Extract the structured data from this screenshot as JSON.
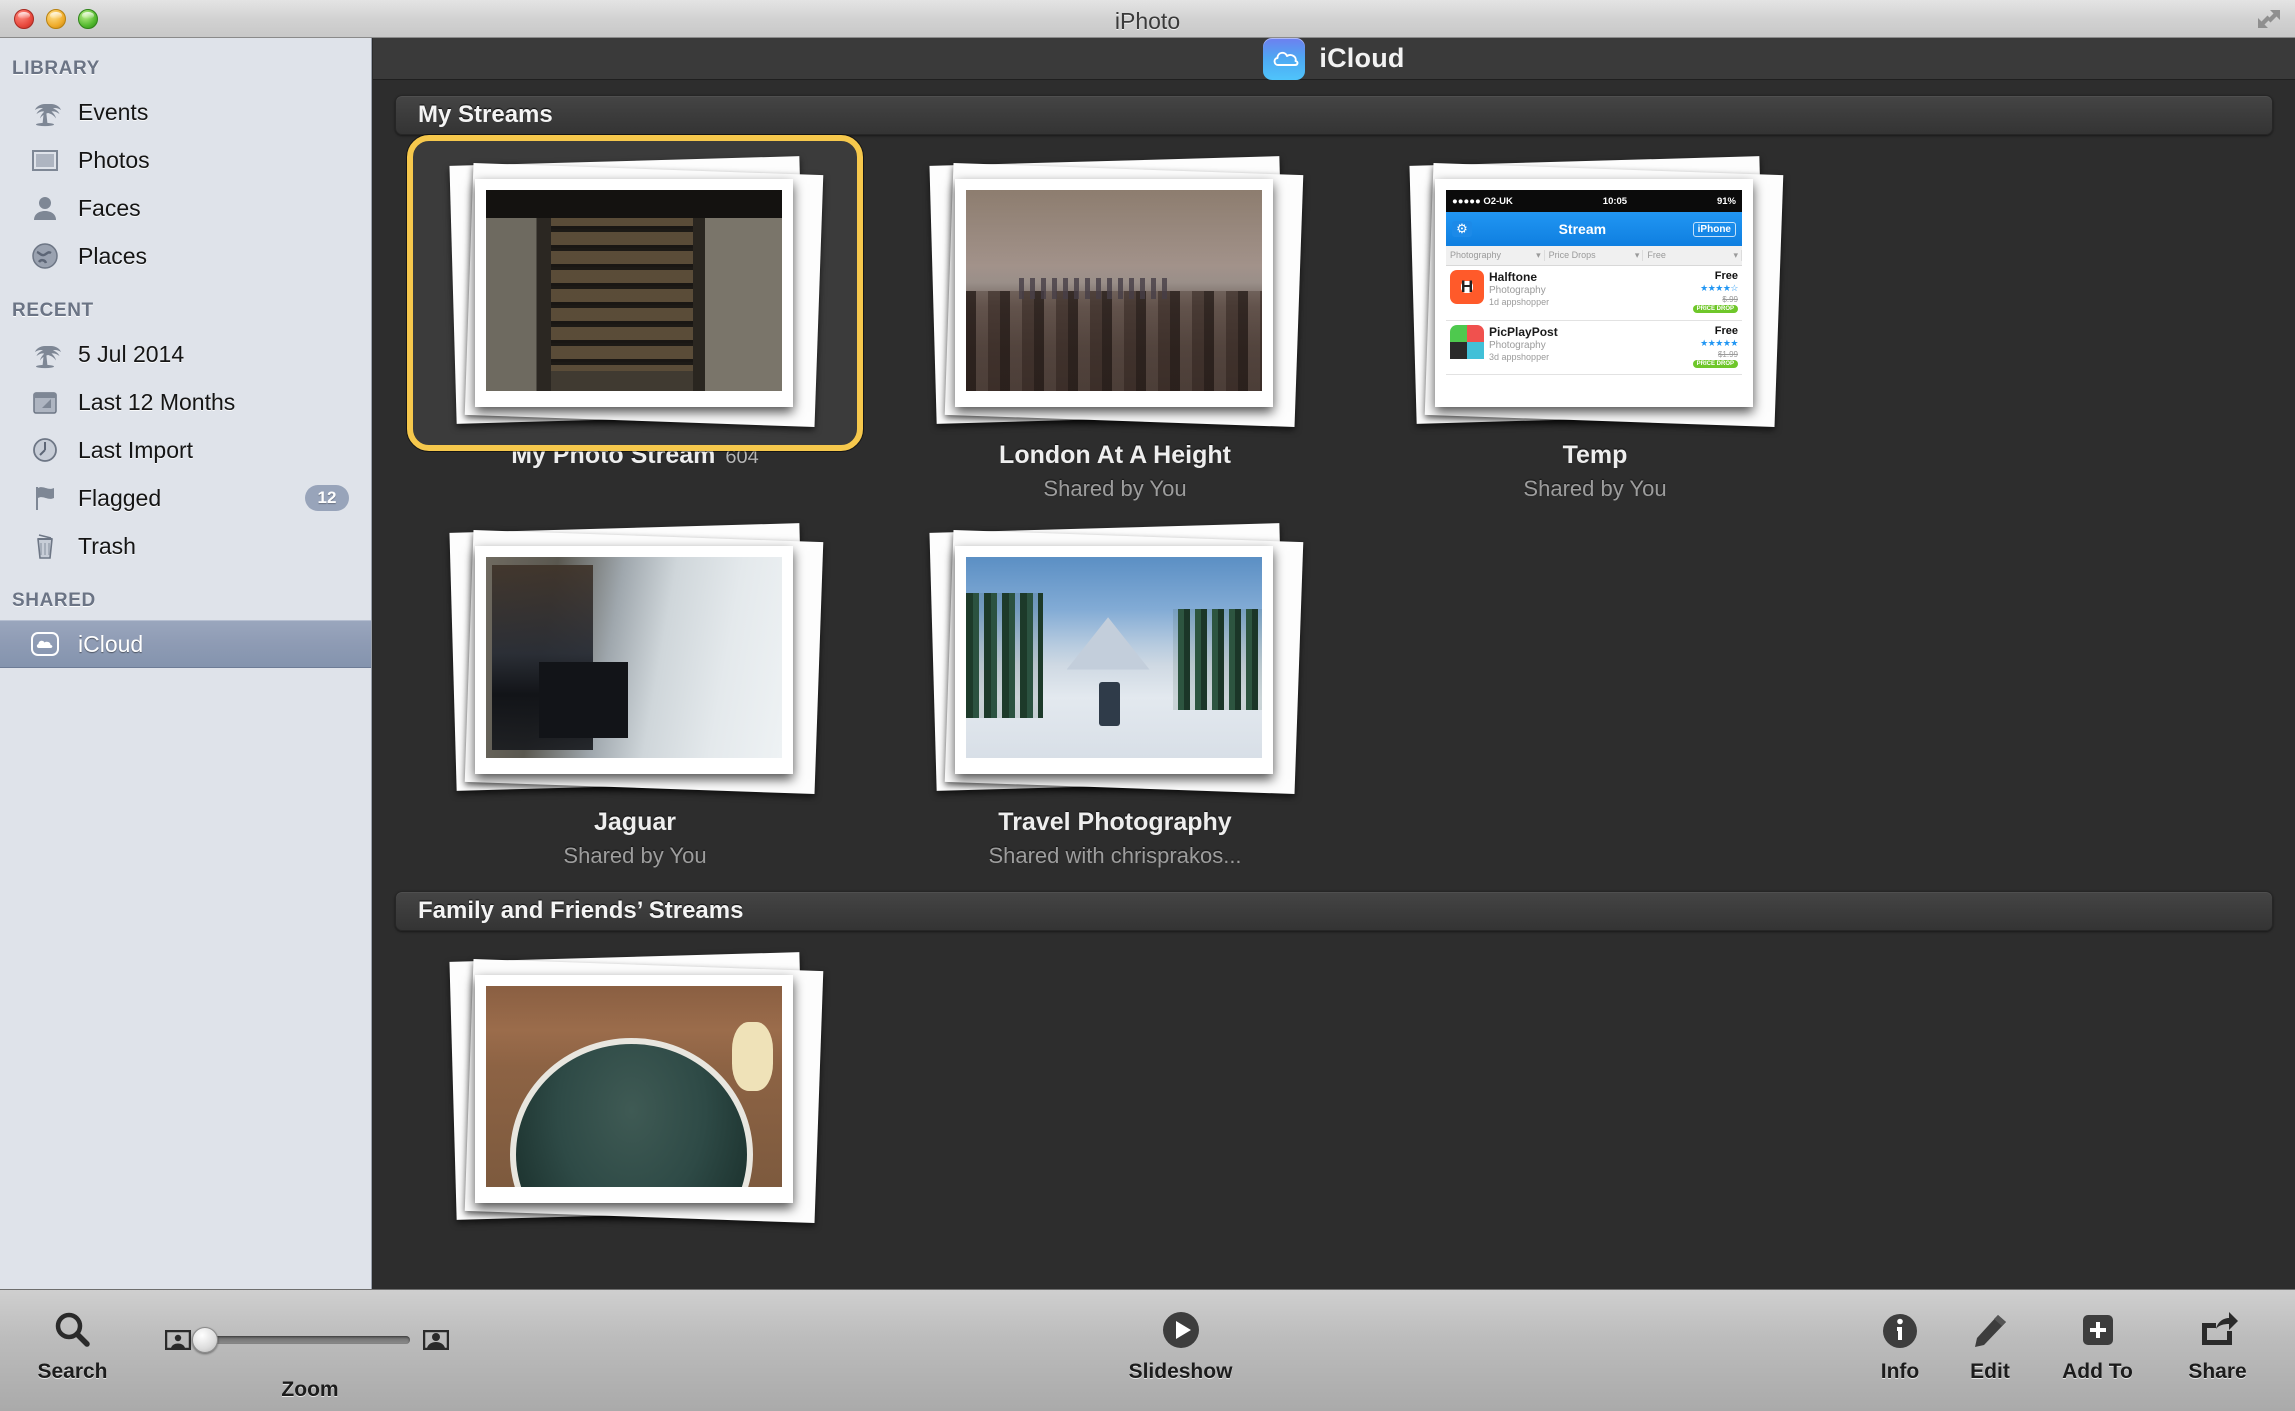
{
  "window": {
    "title": "iPhoto",
    "traffic_lights": [
      "close",
      "minimize",
      "zoom"
    ],
    "fullscreen_icon": "fullscreen-arrows-icon"
  },
  "sidebar": {
    "groups": [
      {
        "title": "LIBRARY",
        "items": [
          {
            "label": "Events",
            "icon": "palm-tree-icon"
          },
          {
            "label": "Photos",
            "icon": "photo-frame-icon"
          },
          {
            "label": "Faces",
            "icon": "person-silhouette-icon"
          },
          {
            "label": "Places",
            "icon": "globe-icon"
          }
        ]
      },
      {
        "title": "RECENT",
        "items": [
          {
            "label": "5 Jul 2014",
            "icon": "palm-tree-icon"
          },
          {
            "label": "Last 12 Months",
            "icon": "calendar-icon"
          },
          {
            "label": "Last Import",
            "icon": "clock-icon"
          },
          {
            "label": "Flagged",
            "icon": "flag-icon",
            "badge": "12"
          },
          {
            "label": "Trash",
            "icon": "trash-icon"
          }
        ]
      },
      {
        "title": "SHARED",
        "items": [
          {
            "label": "iCloud",
            "icon": "icloud-icon",
            "selected": true
          }
        ]
      }
    ]
  },
  "main": {
    "header": {
      "title": "iCloud",
      "icon": "icloud-app-icon"
    },
    "sections": [
      {
        "title": "My Streams",
        "albums": [
          {
            "title": "My Photo Stream",
            "count": "604",
            "subtitle": "",
            "art": "bookshelf",
            "selected": true
          },
          {
            "title": "London At A Height",
            "count": "",
            "subtitle": "Shared by You",
            "art": "london"
          },
          {
            "title": "Temp",
            "count": "",
            "subtitle": "Shared by You",
            "art": "iphone"
          },
          {
            "title": "Jaguar",
            "count": "",
            "subtitle": "Shared by You",
            "art": "jaguar"
          },
          {
            "title": "Travel Photography",
            "count": "",
            "subtitle": "Shared with chrisprakos...",
            "art": "ski"
          }
        ]
      },
      {
        "title": "Family and Friends’ Streams",
        "albums": [
          {
            "title": "",
            "count": "",
            "subtitle": "",
            "art": "food"
          }
        ]
      }
    ],
    "iphone_screenshot": {
      "carrier": "●●●●● O2-UK",
      "time": "10:05",
      "battery": "91%",
      "nav_title": "Stream",
      "nav_right": "iPhone",
      "filters": [
        "Photography",
        "Price Drops",
        "Free"
      ],
      "apps": [
        {
          "name": "Halftone",
          "category": "Photography",
          "age": "1d",
          "source": "appshopper",
          "old_price": "$.99",
          "price": "Free",
          "stars": "★★★★☆",
          "badge": "PRICE DROP"
        },
        {
          "name": "PicPlayPost",
          "category": "Photography",
          "age": "3d",
          "source": "appshopper",
          "old_price": "$1.99",
          "price": "Free",
          "stars": "★★★★★",
          "badge": "PRICE DROP"
        }
      ]
    }
  },
  "toolbar": {
    "search_label": "Search",
    "zoom_label": "Zoom",
    "slideshow_label": "Slideshow",
    "info_label": "Info",
    "edit_label": "Edit",
    "add_to_label": "Add To",
    "share_label": "Share",
    "zoom_value": "0"
  },
  "colors": {
    "selection_ring": "#f6c84c",
    "sidebar_bg": "#dfe3ea",
    "sidebar_selected": "#8e9bb4",
    "main_bg": "#2d2d2d",
    "accent_blue": "#2196f3"
  }
}
